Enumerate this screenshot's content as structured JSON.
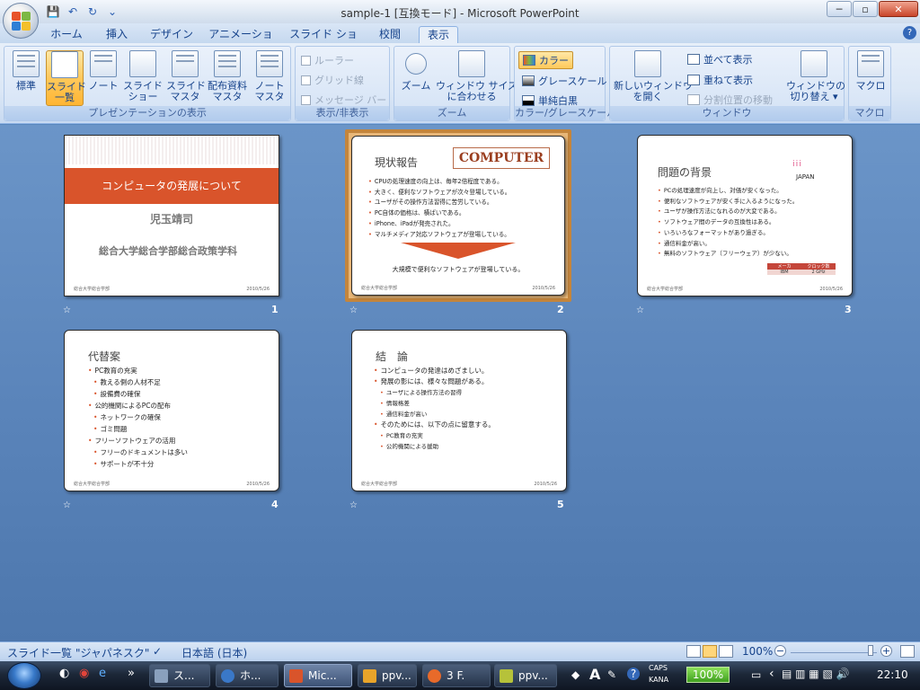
{
  "window": {
    "title": "sample-1 [互換モード] - Microsoft PowerPoint",
    "minimize": "─",
    "maximize": "▫",
    "close": "✕"
  },
  "qat": {
    "save": "💾",
    "undo": "↶",
    "redo": "↻",
    "more": "⌄"
  },
  "tabs": [
    "ホーム",
    "挿入",
    "デザイン",
    "アニメーション",
    "スライド ショー",
    "校閲",
    "表示"
  ],
  "active_tab": "表示",
  "help": "?",
  "ribbon": {
    "group_views": {
      "title": "プレゼンテーションの表示",
      "normal": "標準",
      "sorter": "スライド\n一覧",
      "notes": "ノート",
      "show": "スライド\nショー",
      "slide_master": "スライド\nマスタ",
      "handout_master": "配布資料\nマスタ",
      "notes_master": "ノート\nマスタ"
    },
    "group_showhide": {
      "title": "表示/非表示",
      "ruler": "ルーラー",
      "grid": "グリッド線",
      "message_bar": "メッセージ バー"
    },
    "group_zoom": {
      "title": "ズーム",
      "zoom": "ズーム",
      "fit": "ウィンドウ サイズ\nに合わせる"
    },
    "group_color": {
      "title": "カラー/グレースケール",
      "color": "カラー",
      "grayscale": "グレースケール",
      "bw": "単純白黒"
    },
    "group_window": {
      "title": "ウィンドウ",
      "new_window": "新しいウィンドウ\nを開く",
      "arrange": "並べて表示",
      "cascade": "重ねて表示",
      "split": "分割位置の移動",
      "switch": "ウィンドウの\n切り替え ▾"
    },
    "group_macro": {
      "title": "マクロ",
      "macro": "マクロ"
    }
  },
  "slides": [
    {
      "num": "1",
      "title": "コンピュータの発展について",
      "author": "児玉靖司",
      "org": "総合大学総合学部総合政策学科",
      "footer_left": "総合大学総合学部",
      "footer_right": "2010/5/26"
    },
    {
      "num": "2",
      "title": "現状報告",
      "banner": "COMPUTER",
      "bullets": [
        "CPUの処理速度の向上は、毎年2倍程度である。",
        "大きく、便利なソフトウェアが次々登場している。",
        "ユーザがその操作方法習得に苦労している。",
        "PC自体の価格は、横ばいである。",
        "iPhone、iPadが発売された。",
        "マルチメディア対応ソフトウェアが登場している。"
      ],
      "conclusion": "大規模で便利なソフトウェアが登場している。",
      "footer_left": "総合大学総合学部",
      "footer_right": "2010/5/26"
    },
    {
      "num": "3",
      "title": "問題の背景",
      "logo": "JAPAN",
      "bullets": [
        "PCの処理速度が向上し、対価が安くなった。",
        "便利なソフトウェアが安く手に入るようになった。",
        "ユーザが操作方法になれるのが大変である。",
        "ソフトウェア間のデータの互換性はある。",
        "いろいろなフォーマットがあり過ぎる。",
        "通信料金が高い。",
        "無料のソフトウェア（フリーウェア）が少ない。"
      ],
      "table_head": [
        "メーカ",
        "クロック数"
      ],
      "table_row": [
        "IBM",
        "2 GHz"
      ],
      "footer_left": "総合大学総合学部",
      "footer_right": "2010/5/26"
    },
    {
      "num": "4",
      "title": "代替案",
      "bullets": [
        {
          "t": "PC教育の充実",
          "lv": 0
        },
        {
          "t": "教える側の人材不足",
          "lv": 1
        },
        {
          "t": "設備費の確保",
          "lv": 1
        },
        {
          "t": "公的機関によるPCの配布",
          "lv": 0
        },
        {
          "t": "ネットワークの確保",
          "lv": 1
        },
        {
          "t": "ゴミ問題",
          "lv": 1
        },
        {
          "t": "フリーソフトウェアの活用",
          "lv": 0
        },
        {
          "t": "フリーのドキュメントは多い",
          "lv": 1
        },
        {
          "t": "サポートが不十分",
          "lv": 1
        }
      ],
      "footer_left": "総合大学総合学部",
      "footer_right": "2010/5/26"
    },
    {
      "num": "5",
      "title": "結　論",
      "bullets": [
        {
          "t": "コンピュータの発達はめざましい。",
          "lv": 0
        },
        {
          "t": "発展の影には、様々な問題がある。",
          "lv": 0
        },
        {
          "t": "ユーザによる操作方法の習得",
          "lv": 2
        },
        {
          "t": "情報格差",
          "lv": 2
        },
        {
          "t": "通信料金が高い",
          "lv": 2
        },
        {
          "t": "そのためには、以下の点に留意する。",
          "lv": 0
        },
        {
          "t": "PC教育の充実",
          "lv": 2
        },
        {
          "t": "公的機関による援助",
          "lv": 2
        }
      ],
      "footer_left": "総合大学総合学部",
      "footer_right": "2010/5/26"
    }
  ],
  "star": "☆",
  "status": {
    "view": "スライド一覧",
    "theme": "\"ジャパネスク\"",
    "lang": "日本語 (日本)",
    "zoom": "100%",
    "zoom_minus": "−",
    "zoom_plus": "+"
  },
  "taskbar": {
    "items": [
      "ス...",
      "ホ...",
      "Mic...",
      "ppv...",
      "3 F.",
      "ppv..."
    ],
    "caps": "CAPS",
    "kana": "KANA",
    "battery": "100%",
    "a": "A",
    "clock": "22:10",
    "more": "»"
  }
}
